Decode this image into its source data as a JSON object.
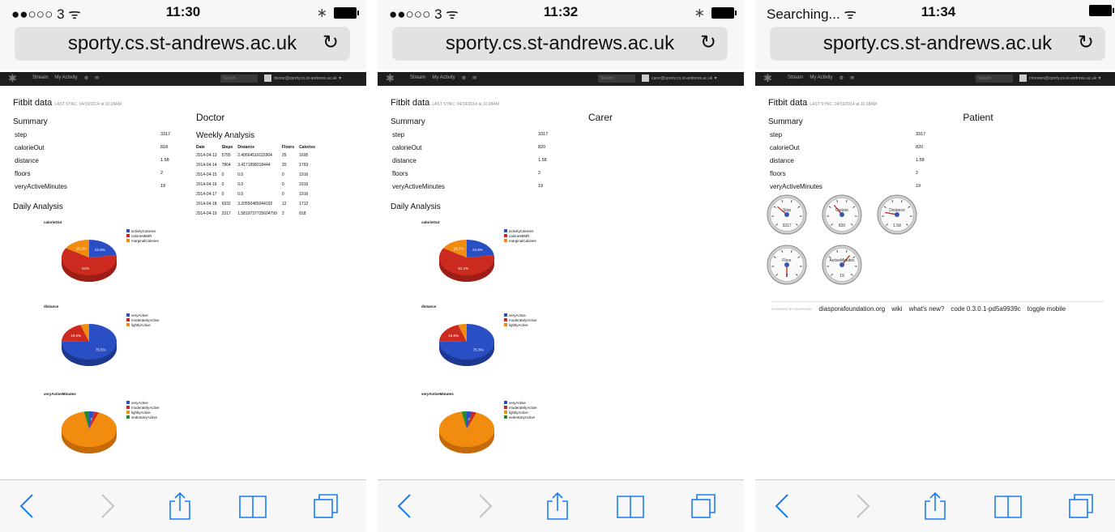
{
  "screens": [
    {
      "status": {
        "left": "●●○○○ 3 ᯤ",
        "time": "11:30"
      },
      "url": "sporty.cs.st-andrews.ac.uk",
      "nav": {
        "links": [
          "Stream",
          "My Activity"
        ],
        "search": "Search",
        "user": "doctor@sporty.cs.st-andrews.ac.uk ▼"
      },
      "fitbit_title": "Fitbit data",
      "last_sync": "LAST SYNC: 04/19/2014 at 10:28AM",
      "summary_title": "Summary",
      "summary": [
        {
          "k": "step",
          "v": "3317"
        },
        {
          "k": "calorieOut",
          "v": "818"
        },
        {
          "k": "distance",
          "v": "1.58"
        },
        {
          "k": "floors",
          "v": "2"
        },
        {
          "k": "veryActiveMinutes",
          "v": "19"
        }
      ],
      "role": "Doctor",
      "daily_title": "Daily Analysis",
      "weekly_title": "Weekly Analysis",
      "weekly_headers": [
        "Date",
        "Steps",
        "Distance",
        "Floors",
        "Calories"
      ],
      "weekly_rows": [
        [
          "2014-04-13",
          "5755",
          "2.40664519115904",
          "25",
          "1695"
        ],
        [
          "2014-04-14",
          "7864",
          "3.4171998018444",
          "20",
          "1793"
        ],
        [
          "2014-04-15",
          "0",
          "0.0",
          "0",
          "1916"
        ],
        [
          "2014-04-16",
          "0",
          "0.0",
          "0",
          "1916"
        ],
        [
          "2014-04-17",
          "0",
          "0.0",
          "0",
          "1916"
        ],
        [
          "2014-04-18",
          "6932",
          "3.20550485044192",
          "12",
          "1712"
        ],
        [
          "2014-04-19",
          "3317",
          "1.5819737725604799",
          "2",
          "818"
        ]
      ],
      "pies": [
        {
          "title": "calorieOut",
          "labels": [
            "22.8%",
            "61%",
            "16.1%"
          ]
        },
        {
          "title": "distance",
          "labels": [
            "75.5%",
            "19.6%",
            ""
          ]
        },
        {
          "title": "veryActiveMinutes",
          "labels": [
            "91.2%",
            "",
            "",
            ""
          ]
        }
      ]
    },
    {
      "status": {
        "left": "●●○○○ 3 ᯤ",
        "time": "11:32"
      },
      "url": "sporty.cs.st-andrews.ac.uk",
      "nav": {
        "links": [
          "Stream",
          "My Activity"
        ],
        "search": "Search",
        "user": "carer@sporty.cs.st-andrews.ac.uk ▼"
      },
      "fitbit_title": "Fitbit data",
      "last_sync": "LAST SYNC: 04/19/2014 at 10:28AM",
      "summary_title": "Summary",
      "summary": [
        {
          "k": "step",
          "v": "3317"
        },
        {
          "k": "calorieOut",
          "v": "820"
        },
        {
          "k": "distance",
          "v": "1.58"
        },
        {
          "k": "floors",
          "v": "2"
        },
        {
          "k": "veryActiveMinutes",
          "v": "19"
        }
      ],
      "role": "Carer",
      "daily_title": "Daily Analysis",
      "pies": [
        {
          "title": "calorieOut",
          "labels": [
            "22.8%",
            "61.1%",
            "16.1%"
          ]
        },
        {
          "title": "distance",
          "labels": [
            "75.3%",
            "19.6%",
            ""
          ]
        },
        {
          "title": "veryActiveMinutes",
          "labels": [
            "91.2%",
            "",
            "",
            ""
          ]
        }
      ]
    },
    {
      "status": {
        "left": "Searching... ᯤ",
        "time": "11:34"
      },
      "url": "sporty.cs.st-andrews.ac.uk",
      "nav": {
        "links": [
          "Stream",
          "My Activity"
        ],
        "search": "Search",
        "user": "chorsten@sporty.cs.st-andrews.ac.uk ▼"
      },
      "fitbit_title": "Fitbit data",
      "last_sync": "LAST SYNC: 04/19/2014 at 10:28AM",
      "summary_title": "Summary",
      "summary": [
        {
          "k": "step",
          "v": "3317"
        },
        {
          "k": "calorieOut",
          "v": "820"
        },
        {
          "k": "distance",
          "v": "1.58"
        },
        {
          "k": "floors",
          "v": "2"
        },
        {
          "k": "veryActiveMinutes",
          "v": "19"
        }
      ],
      "role": "Patient",
      "gauges": [
        {
          "label": "Step",
          "value": "3317"
        },
        {
          "label": "Calorie",
          "value": "820"
        },
        {
          "label": "Distance",
          "value": "1.58"
        },
        {
          "label": "Floor",
          "value": "2"
        },
        {
          "label": "ActiveMinutes",
          "value": "19"
        }
      ],
      "footer": {
        "powered": "POWERED BY DIASPORA*",
        "links": [
          "diasporafoundation.org",
          "wiki",
          "what's new?",
          "code 0.3.0.1-pd5a9939c",
          "toggle mobile"
        ]
      }
    }
  ],
  "legends": {
    "calorieOut": [
      {
        "name": "activityCalories",
        "color": "#2a4fc4"
      },
      {
        "name": "caloriesBMR",
        "color": "#cc2a1e"
      },
      {
        "name": "marginalCalories",
        "color": "#f28c0f"
      }
    ],
    "distance": [
      {
        "name": "veryActive",
        "color": "#2a4fc4"
      },
      {
        "name": "moderatelyActive",
        "color": "#cc2a1e"
      },
      {
        "name": "lightlyActive",
        "color": "#f28c0f"
      }
    ],
    "veryActiveMinutes": [
      {
        "name": "veryActive",
        "color": "#2a4fc4"
      },
      {
        "name": "moderatelyActive",
        "color": "#cc2a1e"
      },
      {
        "name": "lightlyActive",
        "color": "#f28c0f"
      },
      {
        "name": "sedentaryActive",
        "color": "#1f8c2a"
      }
    ]
  },
  "chart_data": [
    {
      "type": "pie",
      "title": "calorieOut",
      "categories": [
        "activityCalories",
        "caloriesBMR",
        "marginalCalories"
      ],
      "values": [
        22.8,
        61.1,
        16.1
      ]
    },
    {
      "type": "pie",
      "title": "distance",
      "categories": [
        "veryActive",
        "moderatelyActive",
        "lightlyActive"
      ],
      "values": [
        75.3,
        19.6,
        5.1
      ]
    },
    {
      "type": "pie",
      "title": "veryActiveMinutes",
      "categories": [
        "veryActive",
        "moderatelyActive",
        "lightlyActive",
        "sedentaryActive"
      ],
      "values": [
        3.0,
        2.8,
        91.2,
        3.0
      ]
    }
  ],
  "icons": {
    "reload": "↻",
    "back": "back-chevron-icon",
    "forward": "forward-chevron-icon",
    "share": "share-icon",
    "bookmarks": "book-icon",
    "tabs": "tabs-icon"
  }
}
